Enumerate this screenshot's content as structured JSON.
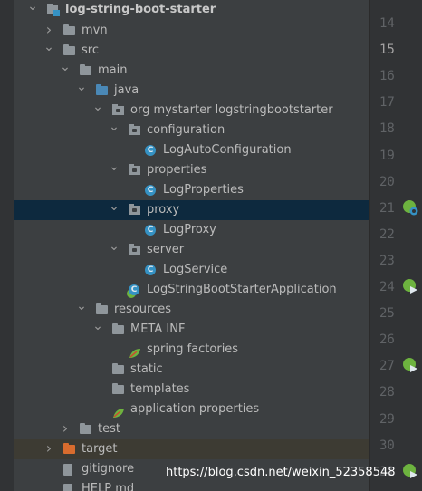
{
  "tree": [
    {
      "label": "log-string-boot-starter",
      "arrow": "down",
      "icon": "module",
      "bold": true
    },
    {
      "label": "mvn",
      "arrow": "right",
      "icon": "folder"
    },
    {
      "label": "src",
      "arrow": "down",
      "icon": "folder"
    },
    {
      "label": "main",
      "arrow": "down",
      "icon": "folder"
    },
    {
      "label": "java",
      "arrow": "down",
      "icon": "folder-blue"
    },
    {
      "label": "org mystarter logstringbootstarter",
      "arrow": "down",
      "icon": "package"
    },
    {
      "label": "configuration",
      "arrow": "down",
      "icon": "package"
    },
    {
      "label": "LogAutoConfiguration",
      "arrow": "",
      "icon": "class"
    },
    {
      "label": "properties",
      "arrow": "down",
      "icon": "package"
    },
    {
      "label": "LogProperties",
      "arrow": "",
      "icon": "class"
    },
    {
      "label": "proxy",
      "arrow": "down",
      "icon": "package",
      "selected": true
    },
    {
      "label": "LogProxy",
      "arrow": "",
      "icon": "class"
    },
    {
      "label": "server",
      "arrow": "down",
      "icon": "package"
    },
    {
      "label": "LogService",
      "arrow": "",
      "icon": "class"
    },
    {
      "label": "LogStringBootStarterApplication",
      "arrow": "",
      "icon": "spring-class"
    },
    {
      "label": "resources",
      "arrow": "down",
      "icon": "folder-res"
    },
    {
      "label": "META INF",
      "arrow": "down",
      "icon": "folder"
    },
    {
      "label": "spring factories",
      "arrow": "",
      "icon": "spring"
    },
    {
      "label": "static",
      "arrow": "",
      "icon": "folder"
    },
    {
      "label": "templates",
      "arrow": "",
      "icon": "folder"
    },
    {
      "label": "application properties",
      "arrow": "",
      "icon": "spring-props"
    },
    {
      "label": "test",
      "arrow": "right",
      "icon": "folder"
    },
    {
      "label": "target",
      "arrow": "right",
      "icon": "folder-orange",
      "target": true
    },
    {
      "label": "gitignore",
      "arrow": "",
      "icon": "file"
    },
    {
      "label": "HELP md",
      "arrow": "",
      "icon": "file"
    }
  ],
  "line_numbers": [
    "14",
    "15",
    "16",
    "17",
    "18",
    "19",
    "20",
    "21",
    "22",
    "23",
    "24",
    "25",
    "26",
    "27",
    "28",
    "29",
    "30",
    "31"
  ],
  "current_line": "15",
  "gutter_icons": [
    {
      "line": "21",
      "icon": "spring-bean-icon"
    },
    {
      "line": "24",
      "icon": "spring-run-icon"
    },
    {
      "line": "27",
      "icon": "spring-run-icon"
    },
    {
      "line": "31",
      "icon": "spring-run-icon"
    }
  ],
  "watermark": "https://blog.csdn.net/weixin_52358548",
  "colors": {
    "background": "#3c3f41",
    "selection": "#0d293e",
    "accent": "#3592c4",
    "spring": "#6db33f"
  }
}
